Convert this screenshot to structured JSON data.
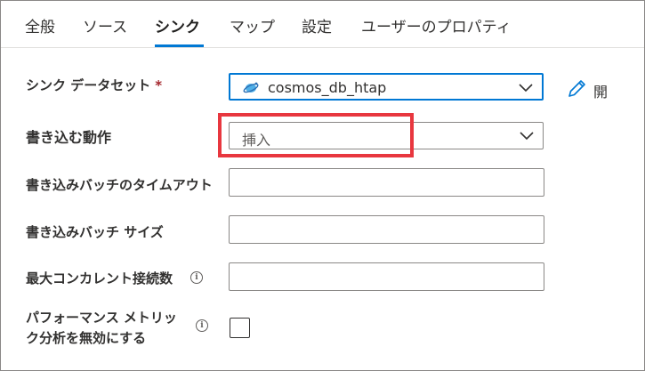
{
  "tabs": [
    {
      "label": "全般"
    },
    {
      "label": "ソース"
    },
    {
      "label": "シンク"
    },
    {
      "label": "マップ"
    },
    {
      "label": "設定"
    },
    {
      "label": "ユーザーのプロパティ"
    }
  ],
  "active_tab": "シンク",
  "form": {
    "sink_dataset": {
      "label": "シンク データセット",
      "required_marker": "*",
      "value": "cosmos_db_htap",
      "open_label": "開"
    },
    "write_behavior": {
      "label": "書き込む動作",
      "value": "挿入"
    },
    "write_batch_timeout": {
      "label": "書き込みバッチのタイムアウト",
      "value": ""
    },
    "write_batch_size": {
      "label": "書き込みバッチ サイズ",
      "value": ""
    },
    "max_concurrent_connections": {
      "label": "最大コンカレント接続数",
      "info": "i",
      "value": ""
    },
    "disable_perf_metrics": {
      "label_line1": "パフォーマンス メトリッ",
      "label_line2": "ク分析を無効にする",
      "info": "i",
      "checked": false
    }
  },
  "colors": {
    "accent": "#0078d4",
    "highlight": "#e8373f"
  },
  "icons": {
    "dataset": "cosmos-db-icon",
    "open": "pencil-icon",
    "dropdown": "chevron-down-icon"
  }
}
